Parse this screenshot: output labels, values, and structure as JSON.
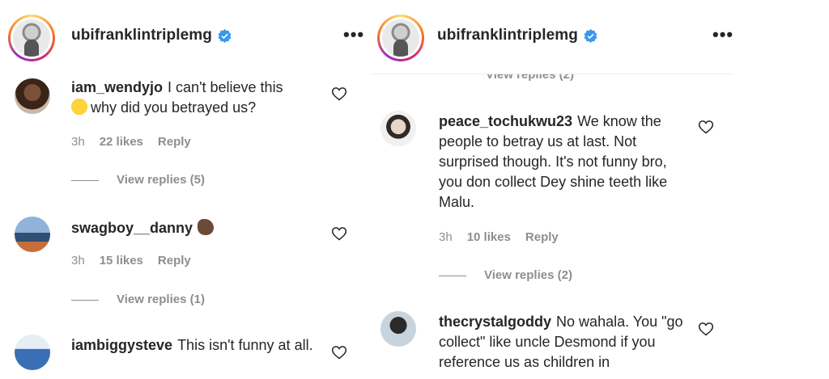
{
  "post_author": {
    "username": "ubifranklintriplemg",
    "verified": true
  },
  "left_panel": {
    "comments": [
      {
        "handle": "iam_wendyjo",
        "text_before_emoji": "I can't believe this",
        "emoji": "face-with-rolling-eyes",
        "text_after_emoji": "why did you betrayed us?",
        "time": "3h",
        "likes": "22 likes",
        "reply": "Reply",
        "view_replies": "View replies (5)"
      },
      {
        "handle": "swagboy__danny",
        "emoji": "rat",
        "time": "3h",
        "likes": "15 likes",
        "reply": "Reply",
        "view_replies": "View replies (1)"
      },
      {
        "handle": "iambiggysteve",
        "text": "This isn't funny at all."
      }
    ]
  },
  "right_panel": {
    "partial_view_replies": "View replies (2)",
    "comments": [
      {
        "handle": "peace_tochukwu23",
        "text": "We know the people to betray us at last. Not surprised though. It's not funny bro, you don collect Dey shine teeth like Malu.",
        "time": "3h",
        "likes": "10 likes",
        "reply": "Reply",
        "view_replies": "View replies (2)"
      },
      {
        "handle": "thecrystalgoddy",
        "text": "No wahala. You \"go collect\" like uncle Desmond if you reference us as children in"
      }
    ]
  },
  "colors": {
    "text": "#262626",
    "meta": "#8e8e8e",
    "verified_badge": "#3897f0"
  }
}
